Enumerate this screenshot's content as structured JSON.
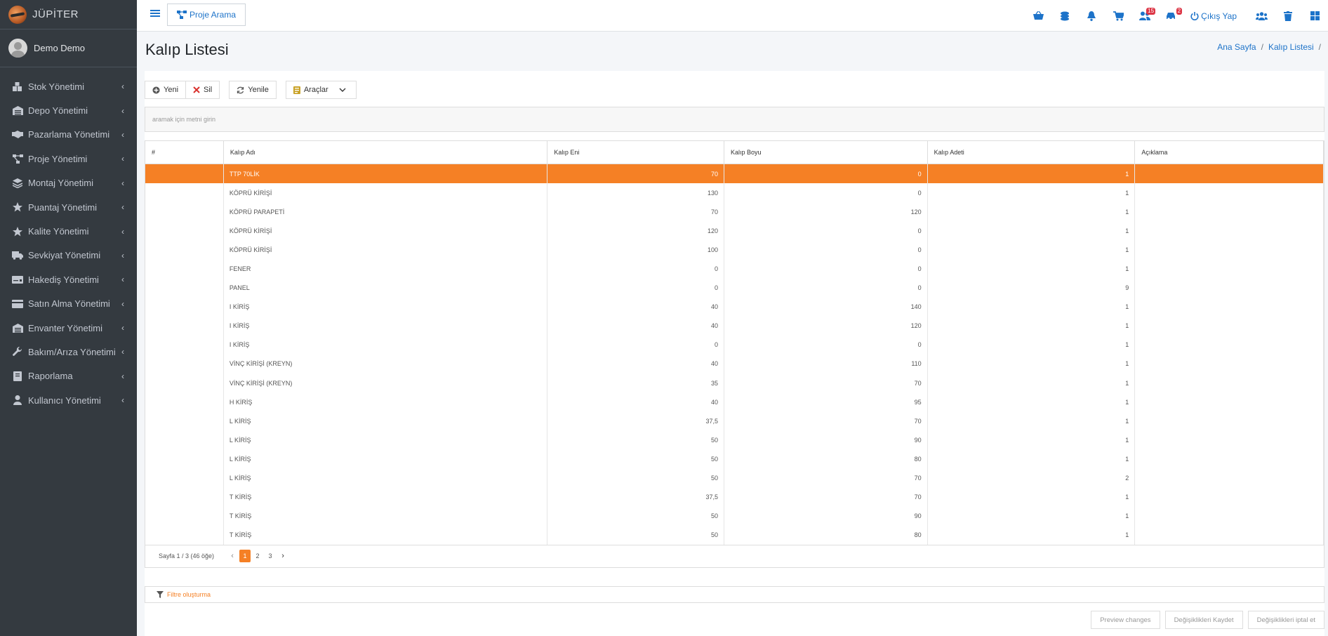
{
  "brand": {
    "name": "JÜPİTER"
  },
  "user": {
    "name": "Demo Demo"
  },
  "sidebar": {
    "items": [
      {
        "label": "Stok Yönetimi",
        "icon": "warehouse-boxes-icon"
      },
      {
        "label": "Depo Yönetimi",
        "icon": "warehouse-icon"
      },
      {
        "label": "Pazarlama Yönetimi",
        "icon": "handshake-icon"
      },
      {
        "label": "Proje Yönetimi",
        "icon": "project-diagram-icon"
      },
      {
        "label": "Montaj Yönetimi",
        "icon": "layers-icon"
      },
      {
        "label": "Puantaj Yönetimi",
        "icon": "star-icon"
      },
      {
        "label": "Kalite Yönetimi",
        "icon": "star-icon"
      },
      {
        "label": "Sevkiyat Yönetimi",
        "icon": "truck-icon"
      },
      {
        "label": "Hakediş Yönetimi",
        "icon": "money-check-icon"
      },
      {
        "label": "Satın Alma Yönetimi",
        "icon": "credit-card-icon"
      },
      {
        "label": "Envanter Yönetimi",
        "icon": "warehouse-icon"
      },
      {
        "label": "Bakım/Arıza Yönetimi",
        "icon": "wrench-icon"
      },
      {
        "label": "Raporlama",
        "icon": "book-icon"
      },
      {
        "label": "Kullanıcı Yönetimi",
        "icon": "user-icon"
      }
    ]
  },
  "topbar": {
    "proje_button": "Proje Arama",
    "badges": {
      "users": "15",
      "cars": "2"
    },
    "logout": "Çıkış Yap"
  },
  "page": {
    "title": "Kalıp Listesi",
    "breadcrumb": [
      "Ana Sayfa",
      "Kalıp Listesi"
    ]
  },
  "toolbar": {
    "new": "Yeni",
    "delete": "Sil",
    "refresh": "Yenile",
    "tools": "Araçlar"
  },
  "search": {
    "placeholder": "aramak için metni girin"
  },
  "table": {
    "headers": [
      "#",
      "Kalıp Adı",
      "Kalıp Eni",
      "Kalıp Boyu",
      "Kalıp Adeti",
      "Açıklama"
    ],
    "rows": [
      [
        "",
        "TTP 70LİK",
        "70",
        "0",
        "1",
        ""
      ],
      [
        "",
        "KÖPRÜ KİRİŞİ",
        "130",
        "0",
        "1",
        ""
      ],
      [
        "",
        "KÖPRÜ PARAPETİ",
        "70",
        "120",
        "1",
        ""
      ],
      [
        "",
        "KÖPRÜ KİRİŞİ",
        "120",
        "0",
        "1",
        ""
      ],
      [
        "",
        "KÖPRÜ KİRİŞİ",
        "100",
        "0",
        "1",
        ""
      ],
      [
        "",
        "FENER",
        "0",
        "0",
        "1",
        ""
      ],
      [
        "",
        "PANEL",
        "0",
        "0",
        "9",
        ""
      ],
      [
        "",
        "I KİRİŞ",
        "40",
        "140",
        "1",
        ""
      ],
      [
        "",
        "I KİRİŞ",
        "40",
        "120",
        "1",
        ""
      ],
      [
        "",
        "I KİRİŞ",
        "0",
        "0",
        "1",
        ""
      ],
      [
        "",
        "VİNÇ KİRİŞİ (KREYN)",
        "40",
        "110",
        "1",
        ""
      ],
      [
        "",
        "VİNÇ KİRİŞİ (KREYN)",
        "35",
        "70",
        "1",
        ""
      ],
      [
        "",
        "H KİRİŞ",
        "40",
        "95",
        "1",
        ""
      ],
      [
        "",
        "L KİRİŞ",
        "37,5",
        "70",
        "1",
        ""
      ],
      [
        "",
        "L KİRİŞ",
        "50",
        "90",
        "1",
        ""
      ],
      [
        "",
        "L KİRİŞ",
        "50",
        "80",
        "1",
        ""
      ],
      [
        "",
        "L KİRİŞ",
        "50",
        "70",
        "2",
        ""
      ],
      [
        "",
        "T KİRİŞ",
        "37,5",
        "70",
        "1",
        ""
      ],
      [
        "",
        "T KİRİŞ",
        "50",
        "90",
        "1",
        ""
      ],
      [
        "",
        "T KİRİŞ",
        "50",
        "80",
        "1",
        ""
      ]
    ],
    "selected_row": 0
  },
  "pager": {
    "info": "Sayfa 1 / 3 (46 öğe)",
    "pages": [
      "1",
      "2",
      "3"
    ],
    "current": "1"
  },
  "filter": {
    "label": "Filtre oluşturma"
  },
  "actions": {
    "preview": "Preview changes",
    "save": "Değişiklikleri Kaydet",
    "cancel": "Değişiklikleri iptal et"
  },
  "colors": {
    "accent": "#f58025",
    "link": "#1d73c9",
    "sidebar": "#343a40"
  }
}
